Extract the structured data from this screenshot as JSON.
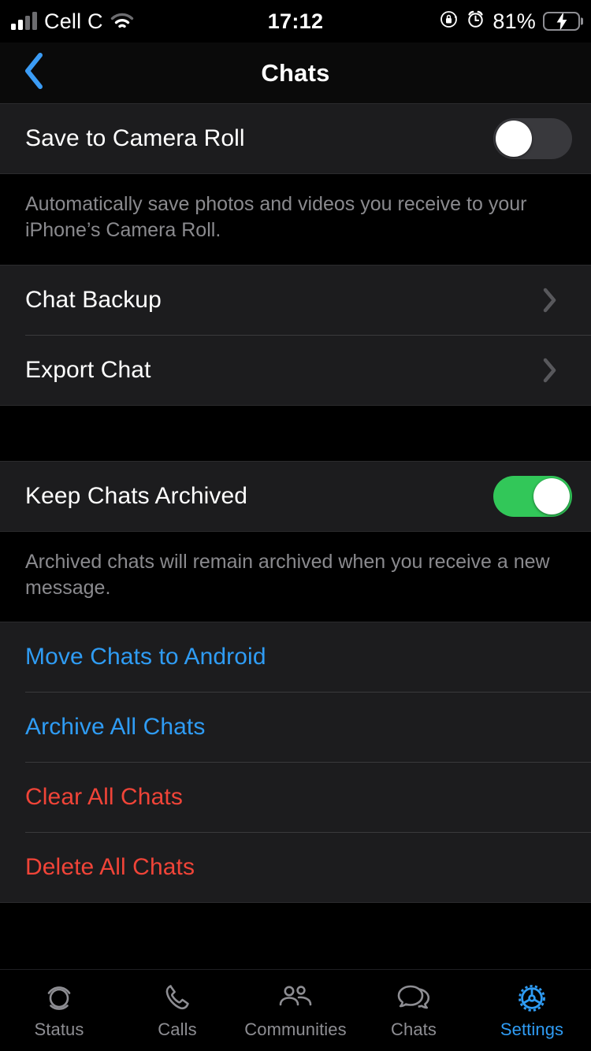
{
  "status_bar": {
    "carrier": "Cell C",
    "time": "17:12",
    "battery_percent": "81%",
    "signal_icon": "cellular-signal-icon",
    "wifi_icon": "wifi-icon",
    "rotation_lock_icon": "rotation-lock-icon",
    "alarm_icon": "alarm-clock-icon",
    "battery_icon": "battery-charging-icon"
  },
  "nav": {
    "back_icon": "chevron-left-icon",
    "title": "Chats"
  },
  "sections": [
    {
      "rows": [
        {
          "label": "Save to Camera Roll",
          "type": "toggle",
          "value": "off"
        }
      ],
      "footer": "Automatically save photos and videos you receive to your iPhone’s Camera Roll."
    },
    {
      "rows": [
        {
          "label": "Chat Backup",
          "type": "disclosure"
        },
        {
          "label": "Export Chat",
          "type": "disclosure"
        }
      ],
      "footer": ""
    },
    {
      "rows": [
        {
          "label": "Keep Chats Archived",
          "type": "toggle",
          "value": "on"
        }
      ],
      "footer": "Archived chats will remain archived when you receive a new message."
    },
    {
      "rows": [
        {
          "label": "Move Chats to Android",
          "type": "action",
          "style": "blue"
        },
        {
          "label": "Archive All Chats",
          "type": "action",
          "style": "blue"
        },
        {
          "label": "Clear All Chats",
          "type": "action",
          "style": "red"
        },
        {
          "label": "Delete All Chats",
          "type": "action",
          "style": "red"
        }
      ],
      "footer": ""
    }
  ],
  "rows": {
    "save_to_camera_roll": "Save to Camera Roll",
    "chat_backup": "Chat Backup",
    "export_chat": "Export Chat",
    "keep_chats_archived": "Keep Chats Archived",
    "move_chats_to_android": "Move Chats to Android",
    "archive_all_chats": "Archive All Chats",
    "clear_all_chats": "Clear All Chats",
    "delete_all_chats": "Delete All Chats"
  },
  "footers": {
    "camera_roll": "Automatically save photos and videos you receive to your iPhone’s Camera Roll.",
    "keep_archived": "Archived chats will remain archived when you receive a new message."
  },
  "tabbar": {
    "tabs": [
      {
        "label": "Status",
        "icon": "status-rings-icon",
        "active": false
      },
      {
        "label": "Calls",
        "icon": "phone-icon",
        "active": false
      },
      {
        "label": "Communities",
        "icon": "communities-people-icon",
        "active": false
      },
      {
        "label": "Chats",
        "icon": "chat-bubbles-icon",
        "active": false
      },
      {
        "label": "Settings",
        "icon": "gear-icon",
        "active": true
      }
    ]
  },
  "colors": {
    "accent_blue": "#2f9cf4",
    "destructive_red": "#f04438",
    "toggle_on_green": "#32c759",
    "toggle_off_gray": "#39393d",
    "row_background": "#1c1c1e",
    "page_background": "#000000",
    "secondary_text": "#8a8a8e"
  }
}
